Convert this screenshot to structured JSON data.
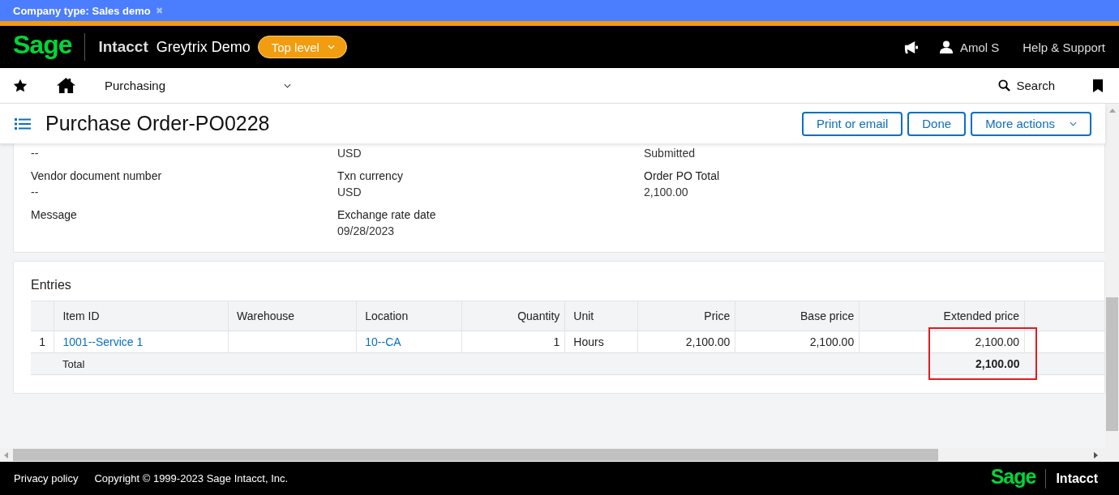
{
  "banner": {
    "text": "Company type: Sales demo",
    "close": "✖"
  },
  "header": {
    "brand": "Sage",
    "product": "Intacct",
    "company": "Greytrix Demo",
    "level_button": "Top level",
    "user": "Amol S",
    "help": "Help & Support"
  },
  "nav": {
    "module": "Purchasing",
    "search": "Search"
  },
  "title_bar": {
    "title": "Purchase Order-PO0228",
    "buttons": [
      "Print or email",
      "Done",
      "More actions"
    ]
  },
  "details": {
    "columns": [
      [
        {
          "value": "--"
        },
        {
          "label": "Vendor document number",
          "value": "--"
        },
        {
          "label": "Message"
        }
      ],
      [
        {
          "value": "USD"
        },
        {
          "label": "Txn currency",
          "value": "USD"
        },
        {
          "label": "Exchange rate date",
          "value": "09/28/2023"
        }
      ],
      [
        {
          "value": "Submitted"
        },
        {
          "label": "Order PO Total",
          "value": "2,100.00"
        }
      ]
    ]
  },
  "entries": {
    "title": "Entries",
    "columns": [
      {
        "label": "Item ID",
        "highlighted": false
      },
      {
        "label": "Warehouse",
        "highlighted": false
      },
      {
        "label": "Location",
        "highlighted": false
      },
      {
        "label": "Quantity",
        "highlighted": false
      },
      {
        "label": "Unit",
        "highlighted": false
      },
      {
        "label": "Price",
        "highlighted": false
      },
      {
        "label": "Base price",
        "highlighted": false
      },
      {
        "label": "Extended price",
        "highlighted": true
      }
    ],
    "rows": [
      {
        "number": "1",
        "cells": [
          {
            "text": "1001--Service 1",
            "link": true
          },
          null,
          {
            "text": "10--CA",
            "link": true
          },
          {
            "text": "1",
            "link": false
          },
          {
            "text": "Hours",
            "link": false
          },
          {
            "text": "2,100.00",
            "link": false
          },
          {
            "text": "2,100.00",
            "link": false
          },
          {
            "text": "2,100.00",
            "link": false
          }
        ]
      }
    ],
    "total": {
      "label": "Total",
      "value": "2,100.00"
    }
  },
  "footer": {
    "privacy": "Privacy policy",
    "copyright": "Copyright © 1999-2023 Sage Intacct, Inc.",
    "brand": "Sage",
    "product": "Intacct"
  }
}
